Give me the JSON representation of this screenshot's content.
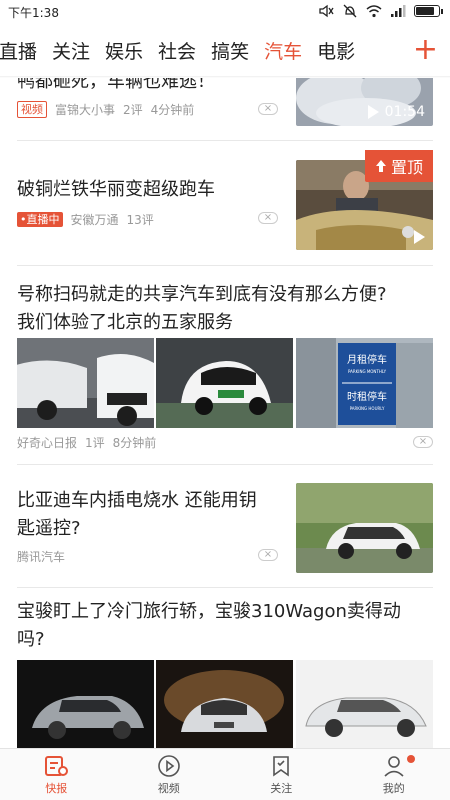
{
  "status_bar": {
    "time": "下午1:38",
    "icons": [
      "mute-icon",
      "no-alarm-icon",
      "wifi-icon",
      "signal-icon",
      "battery-icon"
    ]
  },
  "tabs": {
    "items": [
      "直播",
      "关注",
      "娱乐",
      "社会",
      "搞笑",
      "汽车",
      "电影"
    ],
    "active": "汽车",
    "add_label": "+"
  },
  "feed": [
    {
      "type": "text-thumb",
      "title": "鸭都砸死，车辆也难逃！",
      "badge": "视频",
      "source": "富锦大小事",
      "comments": "2评",
      "time": "4分钟前",
      "duration": "01:54"
    },
    {
      "type": "text-thumb",
      "title": "破铜烂铁华丽变超级跑车",
      "badge": "直播中",
      "source": "安徽万通",
      "comments": "13评",
      "pin_label": "置顶"
    },
    {
      "type": "three-images",
      "title_line1": "号称扫码就走的共享汽车到底有没有那么方便?",
      "title_line2": "我们体验了北京的五家服务",
      "source": "好奇心日报",
      "comments": "1评",
      "time": "8分钟前",
      "sign_text": [
        "月租停车",
        "PARKING MONTHLY",
        "时租停车",
        "PARKING HOURLY"
      ]
    },
    {
      "type": "text-thumb",
      "title_line1": "比亚迪车内插电烧水 还能用钥",
      "title_line2": "匙遥控?",
      "source": "腾讯汽车"
    },
    {
      "type": "three-images",
      "title_line1": "宝骏盯上了冷门旅行轿，宝骏310Wagon卖得动",
      "title_line2": "吗?"
    }
  ],
  "bottom_nav": [
    {
      "label": "快报",
      "icon": "news-icon",
      "active": true
    },
    {
      "label": "视频",
      "icon": "play-circle-icon",
      "active": false
    },
    {
      "label": "关注",
      "icon": "bookmark-icon",
      "active": false
    },
    {
      "label": "我的",
      "icon": "user-icon",
      "active": false,
      "dot": true
    }
  ],
  "colors": {
    "accent": "#e55337",
    "text": "#222222",
    "meta": "#999999"
  }
}
